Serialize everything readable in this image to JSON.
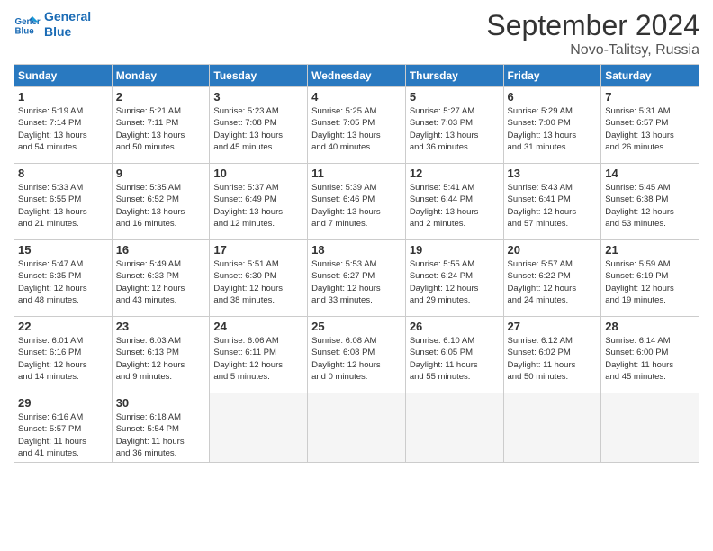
{
  "logo": {
    "line1": "General",
    "line2": "Blue"
  },
  "title": "September 2024",
  "subtitle": "Novo-Talitsy, Russia",
  "weekdays": [
    "Sunday",
    "Monday",
    "Tuesday",
    "Wednesday",
    "Thursday",
    "Friday",
    "Saturday"
  ],
  "weeks": [
    [
      {
        "day": "1",
        "info": "Sunrise: 5:19 AM\nSunset: 7:14 PM\nDaylight: 13 hours\nand 54 minutes."
      },
      {
        "day": "2",
        "info": "Sunrise: 5:21 AM\nSunset: 7:11 PM\nDaylight: 13 hours\nand 50 minutes."
      },
      {
        "day": "3",
        "info": "Sunrise: 5:23 AM\nSunset: 7:08 PM\nDaylight: 13 hours\nand 45 minutes."
      },
      {
        "day": "4",
        "info": "Sunrise: 5:25 AM\nSunset: 7:05 PM\nDaylight: 13 hours\nand 40 minutes."
      },
      {
        "day": "5",
        "info": "Sunrise: 5:27 AM\nSunset: 7:03 PM\nDaylight: 13 hours\nand 36 minutes."
      },
      {
        "day": "6",
        "info": "Sunrise: 5:29 AM\nSunset: 7:00 PM\nDaylight: 13 hours\nand 31 minutes."
      },
      {
        "day": "7",
        "info": "Sunrise: 5:31 AM\nSunset: 6:57 PM\nDaylight: 13 hours\nand 26 minutes."
      }
    ],
    [
      {
        "day": "8",
        "info": "Sunrise: 5:33 AM\nSunset: 6:55 PM\nDaylight: 13 hours\nand 21 minutes."
      },
      {
        "day": "9",
        "info": "Sunrise: 5:35 AM\nSunset: 6:52 PM\nDaylight: 13 hours\nand 16 minutes."
      },
      {
        "day": "10",
        "info": "Sunrise: 5:37 AM\nSunset: 6:49 PM\nDaylight: 13 hours\nand 12 minutes."
      },
      {
        "day": "11",
        "info": "Sunrise: 5:39 AM\nSunset: 6:46 PM\nDaylight: 13 hours\nand 7 minutes."
      },
      {
        "day": "12",
        "info": "Sunrise: 5:41 AM\nSunset: 6:44 PM\nDaylight: 13 hours\nand 2 minutes."
      },
      {
        "day": "13",
        "info": "Sunrise: 5:43 AM\nSunset: 6:41 PM\nDaylight: 12 hours\nand 57 minutes."
      },
      {
        "day": "14",
        "info": "Sunrise: 5:45 AM\nSunset: 6:38 PM\nDaylight: 12 hours\nand 53 minutes."
      }
    ],
    [
      {
        "day": "15",
        "info": "Sunrise: 5:47 AM\nSunset: 6:35 PM\nDaylight: 12 hours\nand 48 minutes."
      },
      {
        "day": "16",
        "info": "Sunrise: 5:49 AM\nSunset: 6:33 PM\nDaylight: 12 hours\nand 43 minutes."
      },
      {
        "day": "17",
        "info": "Sunrise: 5:51 AM\nSunset: 6:30 PM\nDaylight: 12 hours\nand 38 minutes."
      },
      {
        "day": "18",
        "info": "Sunrise: 5:53 AM\nSunset: 6:27 PM\nDaylight: 12 hours\nand 33 minutes."
      },
      {
        "day": "19",
        "info": "Sunrise: 5:55 AM\nSunset: 6:24 PM\nDaylight: 12 hours\nand 29 minutes."
      },
      {
        "day": "20",
        "info": "Sunrise: 5:57 AM\nSunset: 6:22 PM\nDaylight: 12 hours\nand 24 minutes."
      },
      {
        "day": "21",
        "info": "Sunrise: 5:59 AM\nSunset: 6:19 PM\nDaylight: 12 hours\nand 19 minutes."
      }
    ],
    [
      {
        "day": "22",
        "info": "Sunrise: 6:01 AM\nSunset: 6:16 PM\nDaylight: 12 hours\nand 14 minutes."
      },
      {
        "day": "23",
        "info": "Sunrise: 6:03 AM\nSunset: 6:13 PM\nDaylight: 12 hours\nand 9 minutes."
      },
      {
        "day": "24",
        "info": "Sunrise: 6:06 AM\nSunset: 6:11 PM\nDaylight: 12 hours\nand 5 minutes."
      },
      {
        "day": "25",
        "info": "Sunrise: 6:08 AM\nSunset: 6:08 PM\nDaylight: 12 hours\nand 0 minutes."
      },
      {
        "day": "26",
        "info": "Sunrise: 6:10 AM\nSunset: 6:05 PM\nDaylight: 11 hours\nand 55 minutes."
      },
      {
        "day": "27",
        "info": "Sunrise: 6:12 AM\nSunset: 6:02 PM\nDaylight: 11 hours\nand 50 minutes."
      },
      {
        "day": "28",
        "info": "Sunrise: 6:14 AM\nSunset: 6:00 PM\nDaylight: 11 hours\nand 45 minutes."
      }
    ],
    [
      {
        "day": "29",
        "info": "Sunrise: 6:16 AM\nSunset: 5:57 PM\nDaylight: 11 hours\nand 41 minutes."
      },
      {
        "day": "30",
        "info": "Sunrise: 6:18 AM\nSunset: 5:54 PM\nDaylight: 11 hours\nand 36 minutes."
      },
      {
        "day": "",
        "info": ""
      },
      {
        "day": "",
        "info": ""
      },
      {
        "day": "",
        "info": ""
      },
      {
        "day": "",
        "info": ""
      },
      {
        "day": "",
        "info": ""
      }
    ]
  ]
}
